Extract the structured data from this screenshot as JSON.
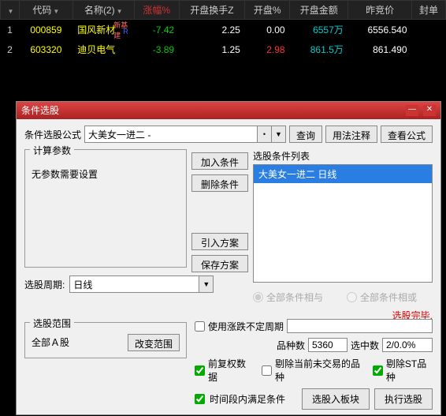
{
  "table": {
    "headers": [
      "代码",
      "名称(2)",
      "涨幅%",
      "开盘换手Z",
      "开盘%",
      "开盘金额",
      "昨竞价",
      "封单"
    ],
    "rows": [
      {
        "n": "1",
        "code": "000859",
        "name": "国风新材",
        "badge1": "新基建",
        "badge2": "R",
        "pct": "-7.42",
        "turn": "2.25",
        "openpct": "0.00",
        "amt": "6557万",
        "prev": "6556.540"
      },
      {
        "n": "2",
        "code": "603320",
        "name": "迪贝电气",
        "pct": "-3.89",
        "turn": "1.25",
        "openpct": "2.98",
        "amt": "861.5万",
        "prev": "861.490"
      }
    ]
  },
  "dialog": {
    "title": "条件选股",
    "formula_label": "条件选股公式",
    "formula_value": "大美女一进二 -",
    "query_btn": "查询",
    "usage_btn": "用法注释",
    "view_btn": "查看公式",
    "param_legend": "计算参数",
    "param_text": "无参数需要设置",
    "period_label": "选股周期:",
    "period_value": "日线",
    "add_btn": "加入条件",
    "del_btn": "删除条件",
    "import_btn": "引入方案",
    "save_btn": "保存方案",
    "cond_list_label": "选股条件列表",
    "cond_item": "大美女一进二  日线",
    "radio_and": "全部条件相与",
    "radio_or": "全部条件相或",
    "status": "选股完毕.",
    "scope_legend": "选股范围",
    "scope_text": "全部Ａ股",
    "scope_btn": "改变范围",
    "use_var_period": "使用涨跌不定周期",
    "count_label": "品种数",
    "count_value": "5360",
    "selected_label": "选中数",
    "selected_value": "2/0.0%",
    "fq_label": "前复权数据",
    "rm_nontrade": "剔除当前未交易的品种",
    "rm_st": "剔除ST品种",
    "time_cond": "时间段内满足条件",
    "to_block_btn": "选股入板块",
    "exec_btn": "执行选股"
  }
}
